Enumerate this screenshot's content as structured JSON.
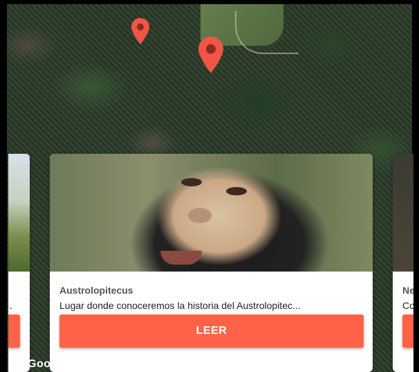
{
  "map": {
    "attribution": "Google",
    "pins": [
      {
        "name": "map-pin-small"
      },
      {
        "name": "map-pin-large"
      }
    ],
    "pin_color": "#f05545"
  },
  "cards": {
    "left": {
      "description_fragment": ".",
      "button_label": ""
    },
    "main": {
      "title": "Austrolopitecus",
      "description": "Lugar donde conoceremos la historia del Austrolopitec...",
      "button_label": "LEER"
    },
    "right": {
      "title_fragment": "Ne",
      "description_fragment": "Co",
      "button_label": ""
    }
  },
  "accent_color": "#ff6347"
}
